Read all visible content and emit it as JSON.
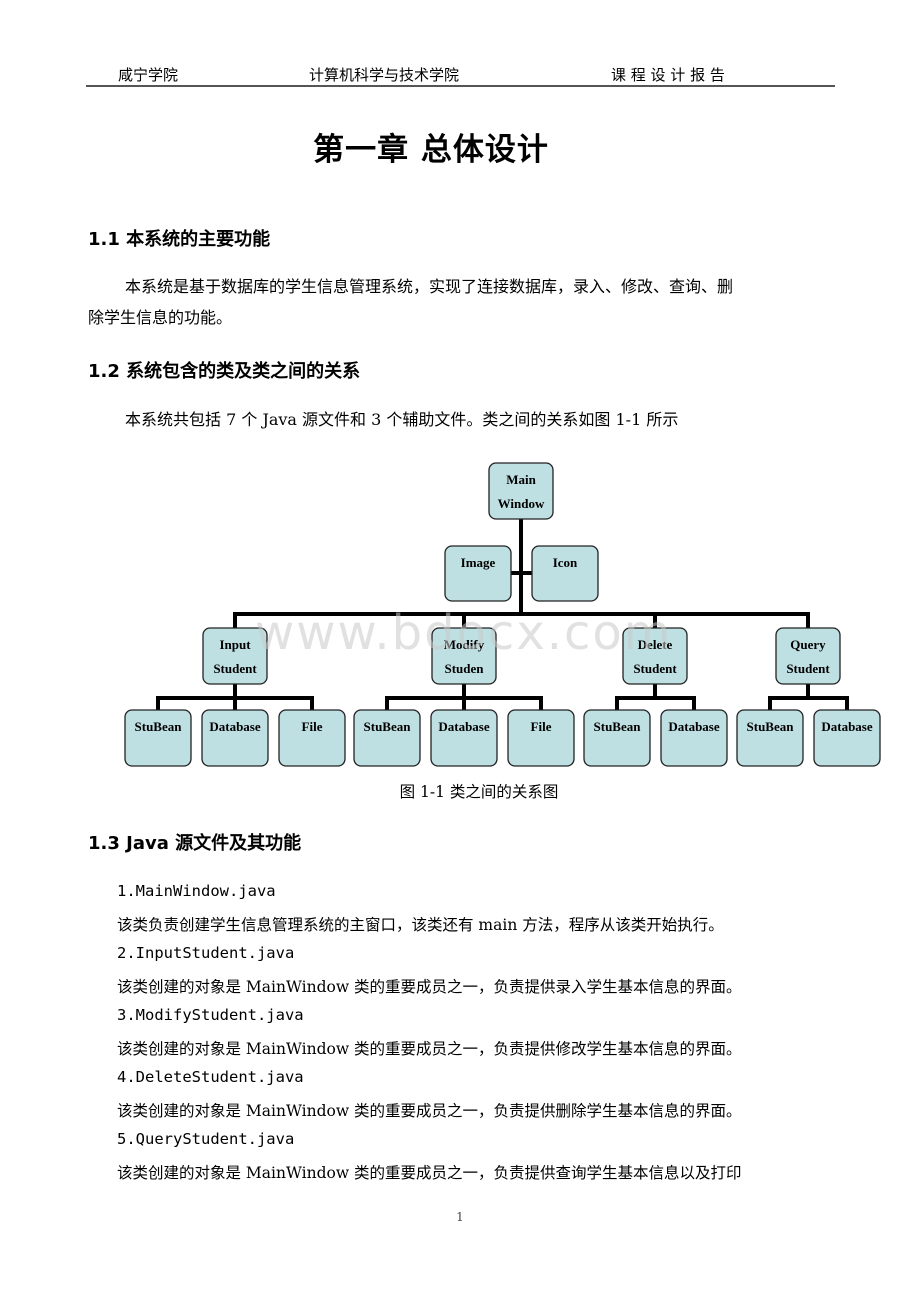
{
  "header": {
    "left": "咸宁学院",
    "center": "计算机科学与技术学院",
    "right": "课 程 设 计 报 告"
  },
  "chapter_title": "第一章  总体设计",
  "sections": [
    {
      "heading": "1.1 本系统的主要功能",
      "paragraph_line1": "本系统是基于数据库的学生信息管理系统，实现了连接数据库，录入、修改、查询、删",
      "paragraph_line2": "除学生信息的功能。"
    },
    {
      "heading": "1.2 系统包含的类及类之间的关系",
      "paragraph": "本系统共包括 7 个 Java 源文件和 3 个辅助文件。类之间的关系如图 1-1 所示"
    },
    {
      "heading": "1.3  Java 源文件及其功能",
      "items": [
        {
          "file": "1.MainWindow.java",
          "desc": "该类负责创建学生信息管理系统的主窗口，该类还有 main 方法，程序从该类开始执行。"
        },
        {
          "file": "2.InputStudent.java",
          "desc": "该类创建的对象是 MainWindow 类的重要成员之一，负责提供录入学生基本信息的界面。"
        },
        {
          "file": "3.ModifyStudent.java",
          "desc": "该类创建的对象是 MainWindow 类的重要成员之一，负责提供修改学生基本信息的界面。"
        },
        {
          "file": "4.DeleteStudent.java",
          "desc": "该类创建的对象是 MainWindow 类的重要成员之一，负责提供删除学生基本信息的界面。"
        },
        {
          "file": "5.QueryStudent.java",
          "desc": "该类创建的对象是 MainWindow 类的重要成员之一，负责提供查询学生基本信息以及打印"
        }
      ]
    }
  ],
  "diagram": {
    "box_fill": "#bfe0e3",
    "root": {
      "line1": "Main",
      "line2": "Window"
    },
    "aux": [
      {
        "label": "Image"
      },
      {
        "label": "Icon"
      }
    ],
    "branches": [
      {
        "line1": "Input",
        "line2": "Student",
        "children": [
          "StuBean",
          "Database",
          "File"
        ]
      },
      {
        "line1": "Modify",
        "line2": "Studen",
        "children": [
          "StuBean",
          "Database",
          "File"
        ]
      },
      {
        "line1": "Delete",
        "line2": "Student",
        "children": [
          "StuBean",
          "Database"
        ]
      },
      {
        "line1": "Query",
        "line2": "Student",
        "children": [
          "StuBean",
          "Database"
        ]
      }
    ],
    "caption": "图  1-1  类之间的关系图"
  },
  "watermark": "www.bdocx.com",
  "page_number": "1"
}
